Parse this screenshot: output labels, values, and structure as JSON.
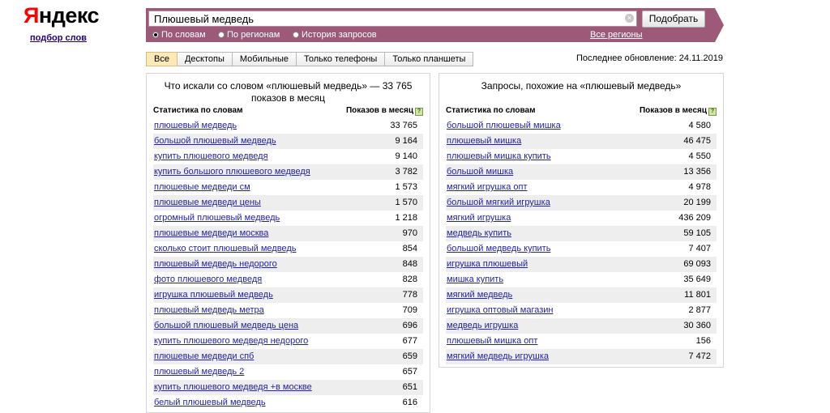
{
  "logo": {
    "first": "Я",
    "rest": "ндекс",
    "subtitle": "подбор слов"
  },
  "search": {
    "value": "Плюшевый медведь",
    "button": "Подобрать",
    "clear": "×"
  },
  "radios": [
    {
      "label": "По словам",
      "checked": true
    },
    {
      "label": "По регионам",
      "checked": false
    },
    {
      "label": "История запросов",
      "checked": false
    }
  ],
  "regions_link": "Все регионы",
  "tabs": [
    "Все",
    "Десктопы",
    "Мобильные",
    "Только телефоны",
    "Только планшеты"
  ],
  "last_update": "Последнее обновление: 24.11.2019",
  "left": {
    "title": "Что искали со словом «плюшевый медведь» — 33 765 показов в месяц",
    "col1": "Статистика по словам",
    "col2": "Показов в месяц",
    "rows": [
      {
        "q": "плюшевый медведь",
        "n": "33 765"
      },
      {
        "q": "большой плюшевый медведь",
        "n": "9 164"
      },
      {
        "q": "купить плюшевого медведя",
        "n": "9 140"
      },
      {
        "q": "купить большого плюшевого медведя",
        "n": "3 782"
      },
      {
        "q": "плюшевые медведи см",
        "n": "1 573"
      },
      {
        "q": "плюшевые медведи цены",
        "n": "1 570"
      },
      {
        "q": "огромный плюшевый медведь",
        "n": "1 218"
      },
      {
        "q": "плюшевые медведи москва",
        "n": "970"
      },
      {
        "q": "сколько стоит плюшевый медведь",
        "n": "854"
      },
      {
        "q": "плюшевый медведь недорого",
        "n": "848"
      },
      {
        "q": "фото плюшевого медведя",
        "n": "828"
      },
      {
        "q": "игрушка плюшевый медведь",
        "n": "778"
      },
      {
        "q": "плюшевый медведь метра",
        "n": "709"
      },
      {
        "q": "большой плюшевый медведь цена",
        "n": "696"
      },
      {
        "q": "купить плюшевого медведя недорого",
        "n": "677"
      },
      {
        "q": "плюшевые медведи спб",
        "n": "659"
      },
      {
        "q": "плюшевый медведь 2",
        "n": "657"
      },
      {
        "q": "купить плюшевого медведя +в москве",
        "n": "651"
      },
      {
        "q": "белый плюшевый медведь",
        "n": "616"
      }
    ]
  },
  "right": {
    "title": "Запросы, похожие на «плюшевый медведь»",
    "col1": "Статистика по словам",
    "col2": "Показов в месяц",
    "rows": [
      {
        "q": "большой плюшевый мишка",
        "n": "4 580"
      },
      {
        "q": "плюшевый мишка",
        "n": "46 475"
      },
      {
        "q": "плюшевый мишка купить",
        "n": "4 550"
      },
      {
        "q": "большой мишка",
        "n": "13 356"
      },
      {
        "q": "мягкий игрушка опт",
        "n": "4 978"
      },
      {
        "q": "большой мягкий игрушка",
        "n": "20 199"
      },
      {
        "q": "мягкий игрушка",
        "n": "436 209"
      },
      {
        "q": "медведь купить",
        "n": "59 105"
      },
      {
        "q": "большой медведь купить",
        "n": "7 407"
      },
      {
        "q": "игрушка плюшевый",
        "n": "69 093"
      },
      {
        "q": "мишка купить",
        "n": "35 649"
      },
      {
        "q": "мягкий медведь",
        "n": "11 801"
      },
      {
        "q": "игрушка оптовый магазин",
        "n": "2 877"
      },
      {
        "q": "медведь игрушка",
        "n": "30 360"
      },
      {
        "q": "плюшевый мишка опт",
        "n": "156"
      },
      {
        "q": "мягкий медведь игрушка",
        "n": "7 472"
      }
    ]
  }
}
